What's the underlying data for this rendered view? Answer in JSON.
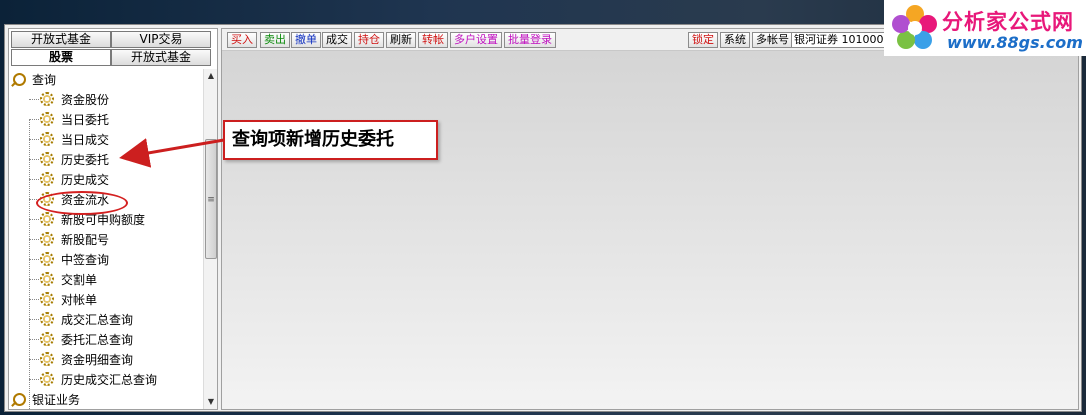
{
  "left_panel": {
    "tabs_row1": [
      "开放式基金",
      "VIP交易"
    ],
    "tabs_row2": [
      "股票",
      "开放式基金"
    ],
    "active_tab": "股票",
    "tree": {
      "root_label": "查询",
      "items": [
        "资金股份",
        "当日委托",
        "当日成交",
        "历史委托",
        "历史成交",
        "资金流水",
        "新股可申购额度",
        "新股配号",
        "中签查询",
        "交割单",
        "对帐单",
        "成交汇总查询",
        "委托汇总查询",
        "资金明细查询",
        "历史成交汇总查询"
      ],
      "highlighted_item": "历史委托",
      "next_root_label": "银证业务"
    },
    "scrollbar": {
      "up_glyph": "▲",
      "down_glyph": "▼",
      "thumb_glyph": "≡"
    }
  },
  "toolbar": {
    "buttons": [
      {
        "label": "买入",
        "color": "#d01010"
      },
      {
        "label": "卖出",
        "color": "#0a8a0a"
      },
      {
        "label": "撤单",
        "color": "#1030c0"
      },
      {
        "label": "成交",
        "color": "#000000"
      },
      {
        "label": "持仓",
        "color": "#d01010"
      },
      {
        "label": "刷新",
        "color": "#000000"
      },
      {
        "label": "转帐",
        "color": "#d01010"
      },
      {
        "label": "多户设置",
        "color": "#c010c0"
      },
      {
        "label": "批量登录",
        "color": "#c010c0"
      }
    ],
    "right_buttons": [
      {
        "label": "锁定",
        "color": "#d01010"
      },
      {
        "label": "系统",
        "color": "#000000"
      },
      {
        "label": "多帐号",
        "color": "#000000"
      }
    ],
    "account": "银河证券  10100001"
  },
  "annotation": {
    "text": "查询项新增历史委托",
    "color": "#cc1f1f"
  },
  "logo": {
    "title": "分析家公式网",
    "url": "www.88gs.com",
    "title_color": "#e8187a",
    "url_color": "#1c6ec8"
  }
}
